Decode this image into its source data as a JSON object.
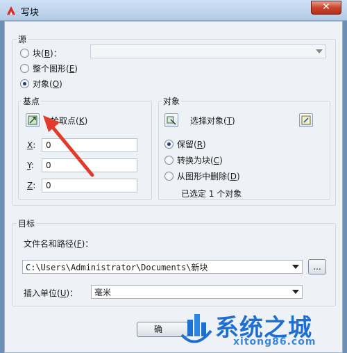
{
  "window": {
    "title": "写块",
    "close_glyph": "✕"
  },
  "source": {
    "group_title": "源",
    "block": {
      "label": "块",
      "key": "B",
      "colon": "："
    },
    "entire_drawing": {
      "label": "整个图形",
      "key": "E"
    },
    "objects": {
      "label": "对象",
      "key": "O"
    },
    "selected": "objects"
  },
  "base_point": {
    "group_title": "基点",
    "pick_label": "拾取点",
    "pick_key": "K",
    "x": {
      "label_key": "X",
      "colon": ":",
      "value": "0"
    },
    "y": {
      "label_key": "Y",
      "colon": ":",
      "value": "0"
    },
    "z": {
      "label_key": "Z",
      "colon": ":",
      "value": "0"
    }
  },
  "objects": {
    "group_title": "对象",
    "select_label": "选择对象",
    "select_key": "T",
    "retain": {
      "label": "保留",
      "key": "R"
    },
    "convert": {
      "label": "转换为块",
      "key": "C"
    },
    "delete": {
      "label": "从图形中删除",
      "key": "D"
    },
    "selected_option": "retain",
    "count_text": "已选定 1 个对象"
  },
  "destination": {
    "group_title": "目标",
    "path_label": "文件名和路径",
    "path_key": "F",
    "path_colon": "：",
    "path_value": "C:\\Users\\Administrator\\Documents\\新块",
    "browse_label": "...",
    "units_label": "插入单位",
    "units_key": "U",
    "units_colon": "：",
    "units_value": "毫米"
  },
  "buttons": {
    "ok_partial": "确"
  },
  "watermark": {
    "name": "系统之城",
    "site": "xitong86.com"
  },
  "colors": {
    "annotation_arrow": "#e23a2c",
    "watermark_blue": "#1f6fd0"
  }
}
